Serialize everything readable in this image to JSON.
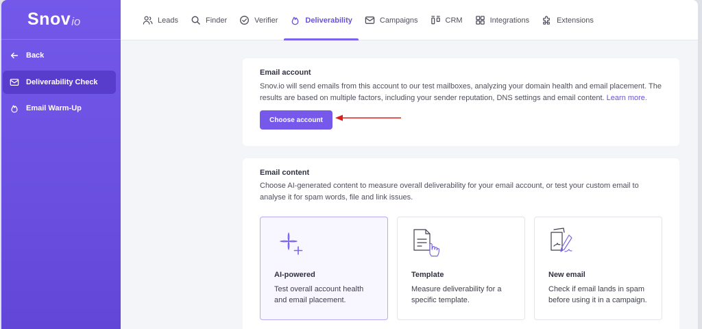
{
  "brand": {
    "name": "Snov",
    "suffix": "io"
  },
  "sidebar": {
    "items": [
      {
        "label": "Back",
        "icon": "arrow-left-icon"
      },
      {
        "label": "Deliverability Check",
        "icon": "mail-check-icon",
        "active": true
      },
      {
        "label": "Email Warm-Up",
        "icon": "flame-icon"
      }
    ]
  },
  "topnav": {
    "items": [
      {
        "label": "Leads",
        "icon": "users-icon"
      },
      {
        "label": "Finder",
        "icon": "search-icon"
      },
      {
        "label": "Verifier",
        "icon": "check-circle-icon"
      },
      {
        "label": "Deliverability",
        "icon": "flame-icon",
        "active": true
      },
      {
        "label": "Campaigns",
        "icon": "envelope-icon"
      },
      {
        "label": "CRM",
        "icon": "kanban-icon"
      },
      {
        "label": "Integrations",
        "icon": "grid-icon"
      },
      {
        "label": "Extensions",
        "icon": "puzzle-icon"
      }
    ]
  },
  "account": {
    "title": "Email account",
    "text": "Snov.io will send emails from this account to our test mailboxes, analyzing your domain health and email placement. The results are based on multiple factors, including your sender reputation, DNS settings and email content.",
    "link": "Learn more.",
    "button": "Choose account"
  },
  "content": {
    "title": "Email content",
    "text": "Choose AI-generated content to measure overall deliverability for your email account, or test your custom email to analyse it for spam words, file and link issues.",
    "options": [
      {
        "title": "AI-powered",
        "desc": "Test overall account health and email placement.",
        "selected": true
      },
      {
        "title": "Template",
        "desc": "Measure deliverability for a specific template."
      },
      {
        "title": "New email",
        "desc": "Check if email lands in spam before using it in a campaign."
      }
    ]
  },
  "colors": {
    "accent": "#7658ea",
    "sidebar": "#6a4fe0",
    "annotation_arrow": "#d9201c"
  }
}
